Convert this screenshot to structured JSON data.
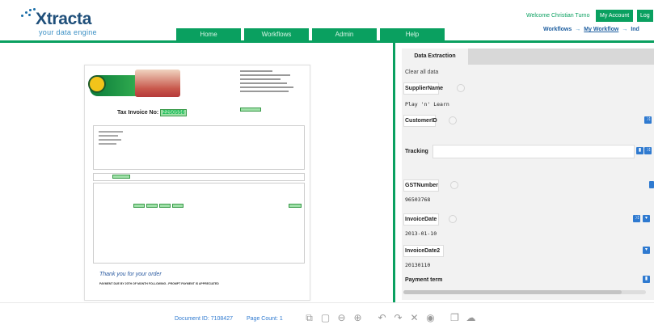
{
  "app": {
    "logo_text": "Xtracta",
    "logo_tagline": "your data engine"
  },
  "nav": {
    "tabs": [
      "Home",
      "Workflows",
      "Admin",
      "Help"
    ]
  },
  "user": {
    "welcome": "Welcome Christian Turno",
    "my_account": "My Account",
    "logout": "Log"
  },
  "breadcrumb": {
    "items": [
      "Workflows",
      "My Workflow",
      "Ind"
    ]
  },
  "invoice": {
    "title": "Tax Invoice No:",
    "number": "2250556",
    "thanks": "Thank you for your order",
    "footer": "PAYMENT DUE BY 20TH OF MONTH FOLLOWING - PROMPT PAYMENT IS APPRECIATED"
  },
  "extraction": {
    "tab_label": "Data Extraction",
    "clear_all": "Clear all data",
    "fields": [
      {
        "label": "SupplierName",
        "value": "Play 'n' Learn"
      },
      {
        "label": "CustomerID",
        "value": ""
      },
      {
        "label": "Tracking",
        "value": ""
      },
      {
        "label": "GSTNumber",
        "value": "96503768"
      },
      {
        "label": "InvoiceDate",
        "value": "2013-01-10"
      },
      {
        "label": "InvoiceDate2",
        "value": "20130110"
      },
      {
        "label": "Payment term",
        "value": ""
      }
    ]
  },
  "footer": {
    "document_id": "Document ID: 7108427",
    "page_count": "Page Count: 1"
  },
  "icons": {
    "toolbar": [
      "fit-page-icon",
      "page-icon",
      "zoom-out-icon",
      "zoom-in-icon",
      "undo-icon",
      "redo-icon",
      "delete-icon",
      "view-icon",
      "copy-icon",
      "upload-icon"
    ]
  },
  "colors": {
    "accent_green": "#0aa060",
    "brand_blue": "#1f4f7a",
    "link_blue": "#2f7ad0"
  }
}
